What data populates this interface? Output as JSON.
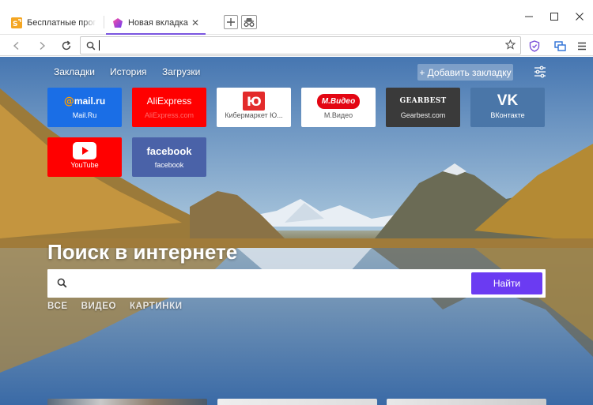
{
  "tabs": [
    {
      "label": "Бесплатные программ",
      "favicon": "softportal-icon",
      "active": false
    },
    {
      "label": "Новая вкладка",
      "favicon": "yandex-browser-icon",
      "active": true,
      "close": "✕"
    }
  ],
  "window_controls": {
    "minimize": "—",
    "maximize": "☐",
    "close": "✕"
  },
  "toolbar": {
    "omnibox_value": ""
  },
  "colors": {
    "accent": "#7a56e0",
    "search_button": "#6b3bf2",
    "mailru": "#1a6ee6",
    "aliexpress": "#ff0000",
    "gearbest": "#3a3a3a",
    "vk": "#4a76a8",
    "youtube": "#ff0000",
    "facebook": "#4a62a8"
  },
  "page": {
    "nav": {
      "bookmarks": "Закладки",
      "history": "История",
      "downloads": "Загрузки"
    },
    "add_bookmark": "+ Добавить закладку",
    "tiles": [
      {
        "logo": "@mail.ru",
        "caption": "Mail.Ru"
      },
      {
        "logo": "AliExpress",
        "caption": "AliExpress.com"
      },
      {
        "logo": "Ю",
        "caption": "Кибермаркет Ю..."
      },
      {
        "logo": "М.Видео",
        "caption": "М.Видео"
      },
      {
        "logo": "GEARBEST",
        "caption": "Gearbest.com"
      },
      {
        "logo": "VK",
        "caption": "ВКонтакте"
      },
      {
        "logo": "YouTube",
        "caption": "YouTube"
      },
      {
        "logo": "facebook",
        "caption": "facebook"
      }
    ],
    "search": {
      "title": "Поиск в интернете",
      "input_value": "",
      "button": "Найти",
      "categories": [
        "ВСЕ",
        "ВИДЕО",
        "КАРТИНКИ"
      ]
    }
  }
}
